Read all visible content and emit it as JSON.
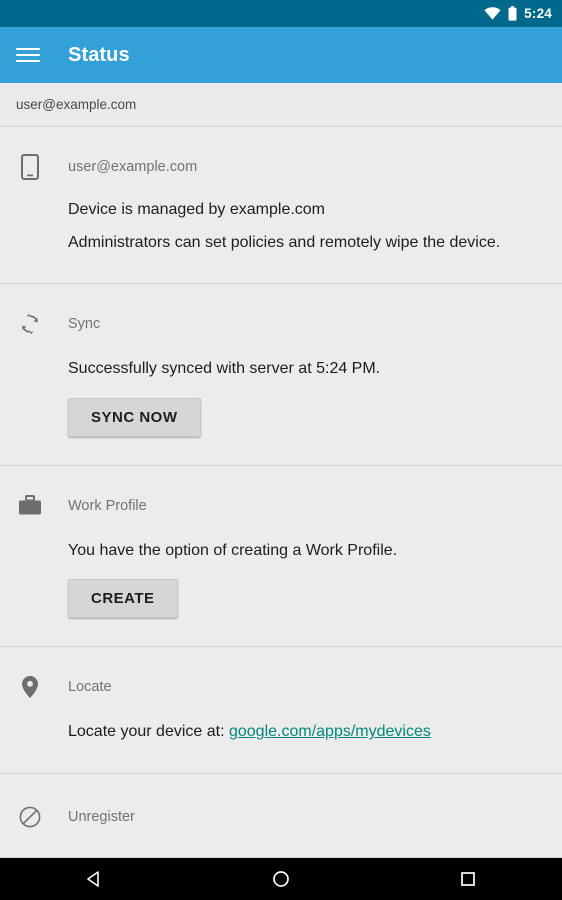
{
  "statusbar": {
    "time": "5:24",
    "icons": [
      "wifi-icon",
      "battery-icon"
    ]
  },
  "appbar": {
    "menu_icon": "hamburger-menu-icon",
    "title": "Status",
    "background_color": "#34a0d8"
  },
  "account": {
    "email": "user@example.com"
  },
  "sections": [
    {
      "key": "device",
      "icon": "smartphone-icon",
      "title": "user@example.com",
      "line1": "Device is managed by example.com",
      "line2": "Administrators can set policies and remotely wipe the device."
    },
    {
      "key": "sync",
      "icon": "sync-icon",
      "title": "Sync",
      "line1": "Successfully synced with server at 5:24 PM.",
      "button": "SYNC NOW"
    },
    {
      "key": "work_profile",
      "icon": "briefcase-icon",
      "title": "Work Profile",
      "line1": "You have the option of creating a Work Profile.",
      "button": "CREATE"
    },
    {
      "key": "locate",
      "icon": "map-pin-icon",
      "title": "Locate",
      "line_prefix": "Locate your device at: ",
      "link_text": "google.com/apps/mydevices",
      "link_color": "#00897b"
    },
    {
      "key": "unregister",
      "icon": "block-icon",
      "title": "Unregister"
    }
  ],
  "navbar": {
    "back": "back-triangle-icon",
    "home": "home-circle-icon",
    "recents": "recents-square-icon"
  }
}
